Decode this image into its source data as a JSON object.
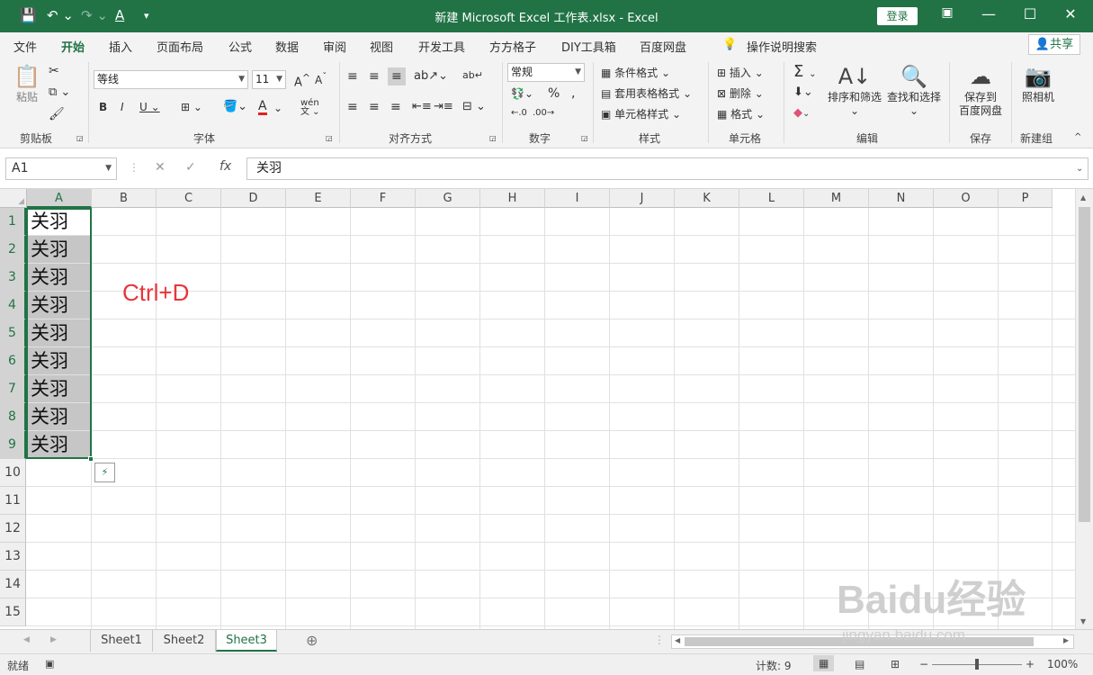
{
  "titlebar": {
    "title": "新建 Microsoft Excel 工作表.xlsx  -  Excel",
    "login": "登录"
  },
  "tabs": [
    "文件",
    "开始",
    "插入",
    "页面布局",
    "公式",
    "数据",
    "审阅",
    "视图",
    "开发工具",
    "方方格子",
    "DIY工具箱",
    "百度网盘"
  ],
  "tell_me": "操作说明搜索",
  "share": "共享",
  "ribbon": {
    "clipboard": {
      "paste": "粘贴",
      "label": "剪贴板"
    },
    "font": {
      "name": "等线",
      "size": "11",
      "label": "字体"
    },
    "alignment": {
      "label": "对齐方式"
    },
    "number": {
      "format": "常规",
      "label": "数字"
    },
    "styles": {
      "conditional": "条件格式",
      "table": "套用表格格式",
      "cell": "单元格样式",
      "label": "样式"
    },
    "cells": {
      "insert": "插入",
      "delete": "删除",
      "format": "格式",
      "label": "单元格"
    },
    "editing": {
      "sort": "排序和筛选",
      "find": "查找和选择",
      "label": "编辑"
    },
    "save": {
      "btn": "保存到百度网盘",
      "btn1": "保存到",
      "btn2": "百度网盘",
      "label": "保存"
    },
    "newgroup": {
      "camera": "照相机",
      "label": "新建组"
    }
  },
  "formula_bar": {
    "name_box": "A1",
    "value": "关羽"
  },
  "columns": [
    "A",
    "B",
    "C",
    "D",
    "E",
    "F",
    "G",
    "H",
    "I",
    "J",
    "K",
    "L",
    "M",
    "N",
    "O",
    "P"
  ],
  "rows": [
    "1",
    "2",
    "3",
    "4",
    "5",
    "6",
    "7",
    "8",
    "9",
    "10",
    "11",
    "12",
    "13",
    "14",
    "15"
  ],
  "cells": [
    "关羽",
    "关羽",
    "关羽",
    "关羽",
    "关羽",
    "关羽",
    "关羽",
    "关羽",
    "关羽"
  ],
  "annotation": "Ctrl+D",
  "sheets": [
    "Sheet1",
    "Sheet2",
    "Sheet3"
  ],
  "active_sheet": "Sheet3",
  "status": {
    "mode": "就绪",
    "count": "计数: 9",
    "zoom": "100%"
  },
  "watermark": {
    "brand": "Baidu经验",
    "url": "jingyan.baidu.com"
  },
  "colors": {
    "accent": "#217346",
    "annotation": "#e8343a"
  }
}
